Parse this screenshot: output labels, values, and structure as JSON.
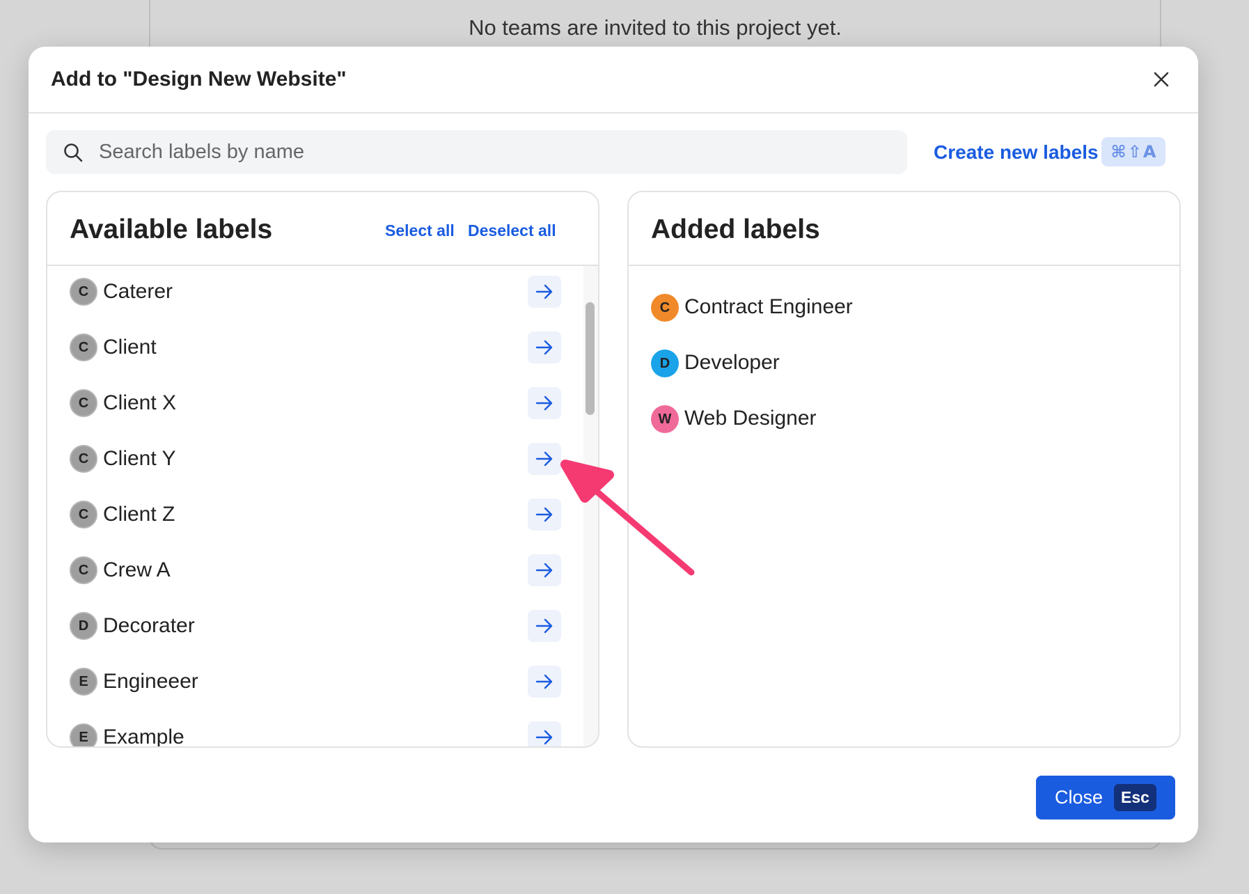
{
  "background": {
    "message": "No teams are invited to this project yet."
  },
  "modal": {
    "title": "Add to \"Design New Website\"",
    "search": {
      "placeholder": "Search labels by name",
      "value": ""
    },
    "create_link": "Create new labels",
    "create_shortcut": {
      "cmd": "⌘",
      "shift": "⇧",
      "key": "A"
    },
    "available": {
      "title": "Available labels",
      "select_all": "Select all",
      "deselect_all": "Deselect all",
      "items": [
        {
          "initial": "C",
          "label": "Caterer"
        },
        {
          "initial": "C",
          "label": "Client"
        },
        {
          "initial": "C",
          "label": "Client X"
        },
        {
          "initial": "C",
          "label": "Client Y"
        },
        {
          "initial": "C",
          "label": "Client Z"
        },
        {
          "initial": "C",
          "label": "Crew A"
        },
        {
          "initial": "D",
          "label": "Decorater"
        },
        {
          "initial": "E",
          "label": "Engineeer"
        },
        {
          "initial": "E",
          "label": "Example"
        }
      ]
    },
    "added": {
      "title": "Added labels",
      "items": [
        {
          "initial": "C",
          "label": "Contract Engineer",
          "color": "#f0892a"
        },
        {
          "initial": "D",
          "label": "Developer",
          "color": "#1aa3e8"
        },
        {
          "initial": "W",
          "label": "Web Designer",
          "color": "#f06a99"
        }
      ]
    },
    "close_button": {
      "label": "Close",
      "shortcut": "Esc"
    }
  },
  "colors": {
    "accent": "#1a5ce0",
    "annotation": "#f53a72"
  }
}
